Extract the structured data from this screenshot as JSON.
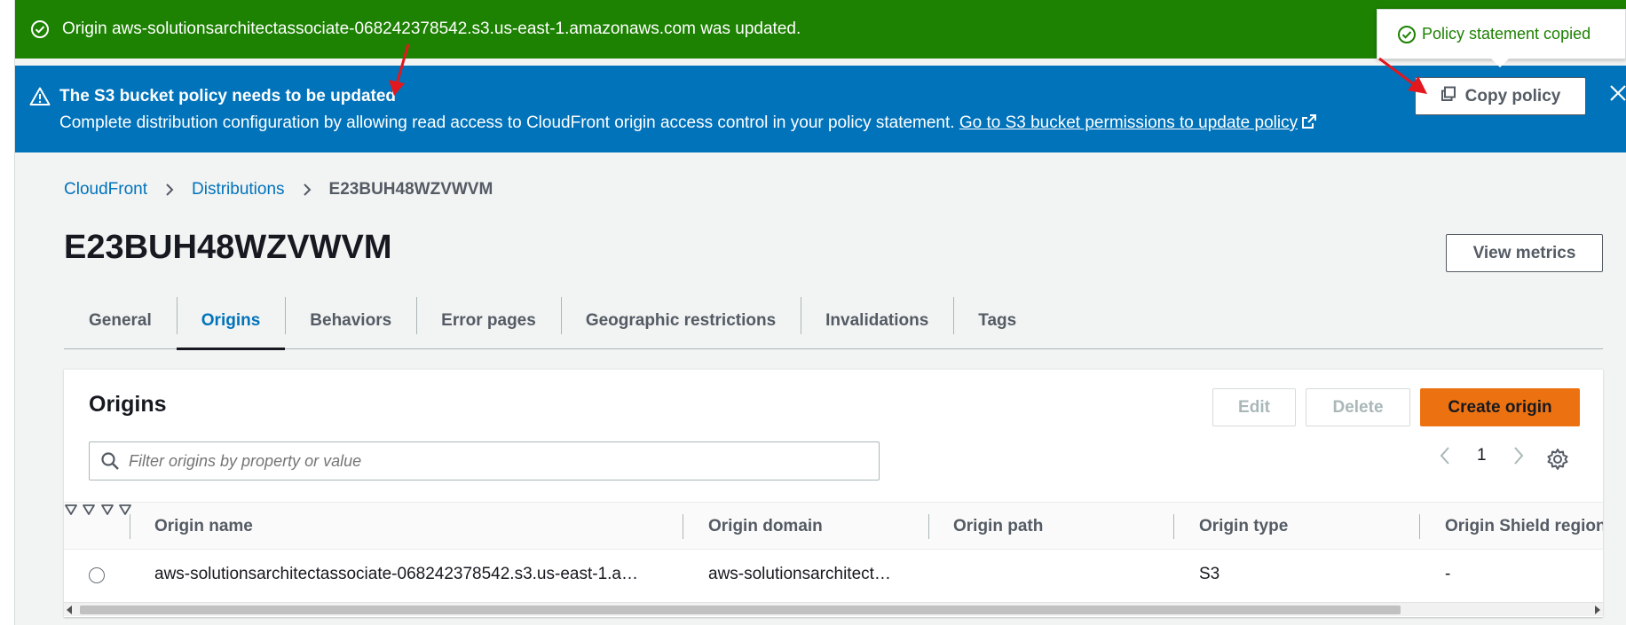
{
  "flash_success": {
    "message": "Origin aws-solutionsarchitectassociate-068242378542.s3.us-east-1.amazonaws.com was updated."
  },
  "flash_info": {
    "title": "The S3 bucket policy needs to be updated",
    "body": "Complete distribution configuration by allowing read access to CloudFront origin access control in your policy statement. ",
    "link": "Go to S3 bucket permissions to update policy",
    "copy_button": "Copy policy"
  },
  "popover": {
    "message": "Policy statement copied"
  },
  "breadcrumb": {
    "items": [
      "CloudFront",
      "Distributions"
    ],
    "current": "E23BUH48WZVWVM"
  },
  "page": {
    "title": "E23BUH48WZVWVM",
    "view_metrics": "View metrics"
  },
  "tabs": [
    "General",
    "Origins",
    "Behaviors",
    "Error pages",
    "Geographic restrictions",
    "Invalidations",
    "Tags"
  ],
  "active_tab": "Origins",
  "origins": {
    "title": "Origins",
    "edit_button": "Edit",
    "delete_button": "Delete",
    "create_button": "Create origin",
    "search_placeholder": "Filter origins by property or value",
    "page_number": "1",
    "columns": [
      "Origin name",
      "Origin domain",
      "Origin path",
      "Origin type",
      "Origin Shield region"
    ],
    "rows": [
      {
        "origin_name": "aws-solutionsarchitectassociate-068242378542.s3.us-east-1.a…",
        "origin_domain": "aws-solutionsarchitect…",
        "origin_path": "",
        "origin_type": "S3",
        "origin_shield_region": "-"
      }
    ]
  },
  "colors": {
    "success": "#1d8102",
    "info": "#0073bb",
    "primary": "#ec7211",
    "annotation_arrow": "#e3171e"
  }
}
